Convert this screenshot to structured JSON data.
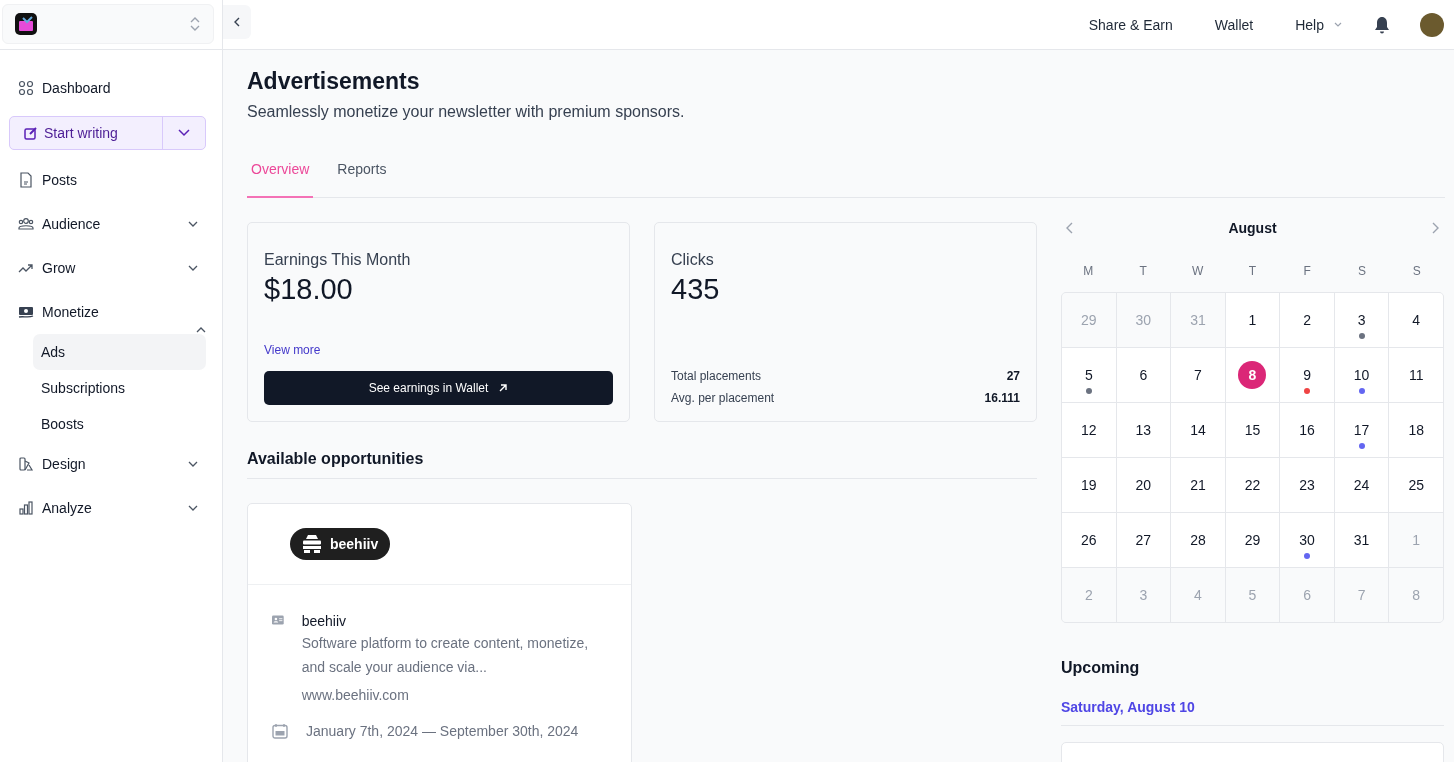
{
  "sidebar": {
    "items": [
      {
        "label": "Dashboard",
        "kind": "link"
      },
      {
        "label": "Start writing",
        "kind": "button"
      },
      {
        "label": "Posts",
        "kind": "link"
      },
      {
        "label": "Audience",
        "kind": "group",
        "expanded": false
      },
      {
        "label": "Grow",
        "kind": "group",
        "expanded": false
      },
      {
        "label": "Monetize",
        "kind": "group",
        "expanded": true,
        "children": [
          {
            "label": "Ads",
            "selected": true
          },
          {
            "label": "Subscriptions",
            "selected": false
          },
          {
            "label": "Boosts",
            "selected": false
          }
        ]
      },
      {
        "label": "Design",
        "kind": "group",
        "expanded": false
      },
      {
        "label": "Analyze",
        "kind": "group",
        "expanded": false
      }
    ]
  },
  "topbar": {
    "links": [
      "Share & Earn",
      "Wallet"
    ],
    "help": "Help"
  },
  "page": {
    "title": "Advertisements",
    "subtitle": "Seamlessly monetize your newsletter with premium sponsors."
  },
  "tabs": [
    {
      "label": "Overview",
      "selected": true
    },
    {
      "label": "Reports",
      "selected": false
    }
  ],
  "earnings": {
    "label": "Earnings This Month",
    "value": "$18.00",
    "link": "View more",
    "button": "See earnings in Wallet"
  },
  "clicks": {
    "label": "Clicks",
    "value": "435",
    "stats": [
      {
        "label": "Total placements",
        "value": "27"
      },
      {
        "label": "Avg. per placement",
        "value": "16.111"
      }
    ]
  },
  "opportunities": {
    "title": "Available opportunities",
    "items": [
      {
        "logo": "beehiiv",
        "name": "beehiiv",
        "description": "Software platform to create content, monetize, and scale your audience via...",
        "url": "www.beehiiv.com",
        "dates": "January 7th, 2024 — September 30th, 2024"
      }
    ]
  },
  "calendar": {
    "month": "August",
    "weekdays": [
      "M",
      "T",
      "W",
      "T",
      "F",
      "S",
      "S"
    ],
    "days": [
      {
        "day": "29",
        "outside": true,
        "selected": false
      },
      {
        "day": "30",
        "outside": true,
        "selected": false
      },
      {
        "day": "31",
        "outside": true,
        "selected": false
      },
      {
        "day": "1",
        "outside": false,
        "selected": false
      },
      {
        "day": "2",
        "outside": false,
        "selected": false
      },
      {
        "day": "3",
        "outside": false,
        "selected": false,
        "color": "#6b7280"
      },
      {
        "day": "4",
        "outside": false,
        "selected": false
      },
      {
        "day": "5",
        "outside": false,
        "selected": false,
        "color": "#6b7280"
      },
      {
        "day": "6",
        "outside": false,
        "selected": false
      },
      {
        "day": "7",
        "outside": false,
        "selected": false
      },
      {
        "day": "8",
        "outside": false,
        "selected": true
      },
      {
        "day": "9",
        "outside": false,
        "selected": false,
        "color": "#ef4444"
      },
      {
        "day": "10",
        "outside": false,
        "selected": false,
        "color": "#6366f1"
      },
      {
        "day": "11",
        "outside": false,
        "selected": false
      },
      {
        "day": "12",
        "outside": false,
        "selected": false
      },
      {
        "day": "13",
        "outside": false,
        "selected": false
      },
      {
        "day": "14",
        "outside": false,
        "selected": false
      },
      {
        "day": "15",
        "outside": false,
        "selected": false
      },
      {
        "day": "16",
        "outside": false,
        "selected": false
      },
      {
        "day": "17",
        "outside": false,
        "selected": false,
        "color": "#6366f1"
      },
      {
        "day": "18",
        "outside": false,
        "selected": false
      },
      {
        "day": "19",
        "outside": false,
        "selected": false
      },
      {
        "day": "20",
        "outside": false,
        "selected": false
      },
      {
        "day": "21",
        "outside": false,
        "selected": false
      },
      {
        "day": "22",
        "outside": false,
        "selected": false
      },
      {
        "day": "23",
        "outside": false,
        "selected": false
      },
      {
        "day": "24",
        "outside": false,
        "selected": false
      },
      {
        "day": "25",
        "outside": false,
        "selected": false
      },
      {
        "day": "26",
        "outside": false,
        "selected": false
      },
      {
        "day": "27",
        "outside": false,
        "selected": false
      },
      {
        "day": "28",
        "outside": false,
        "selected": false
      },
      {
        "day": "29",
        "outside": false,
        "selected": false
      },
      {
        "day": "30",
        "outside": false,
        "selected": false,
        "color": "#6366f1"
      },
      {
        "day": "31",
        "outside": false,
        "selected": false
      },
      {
        "day": "1",
        "outside": true,
        "selected": false
      },
      {
        "day": "2",
        "outside": true,
        "selected": false
      },
      {
        "day": "3",
        "outside": true,
        "selected": false
      },
      {
        "day": "4",
        "outside": true,
        "selected": false
      },
      {
        "day": "5",
        "outside": true,
        "selected": false
      },
      {
        "day": "6",
        "outside": true,
        "selected": false
      },
      {
        "day": "7",
        "outside": true,
        "selected": false
      },
      {
        "day": "8",
        "outside": true,
        "selected": false
      }
    ]
  },
  "upcoming": {
    "title": "Upcoming",
    "date": "Saturday, August 10"
  }
}
